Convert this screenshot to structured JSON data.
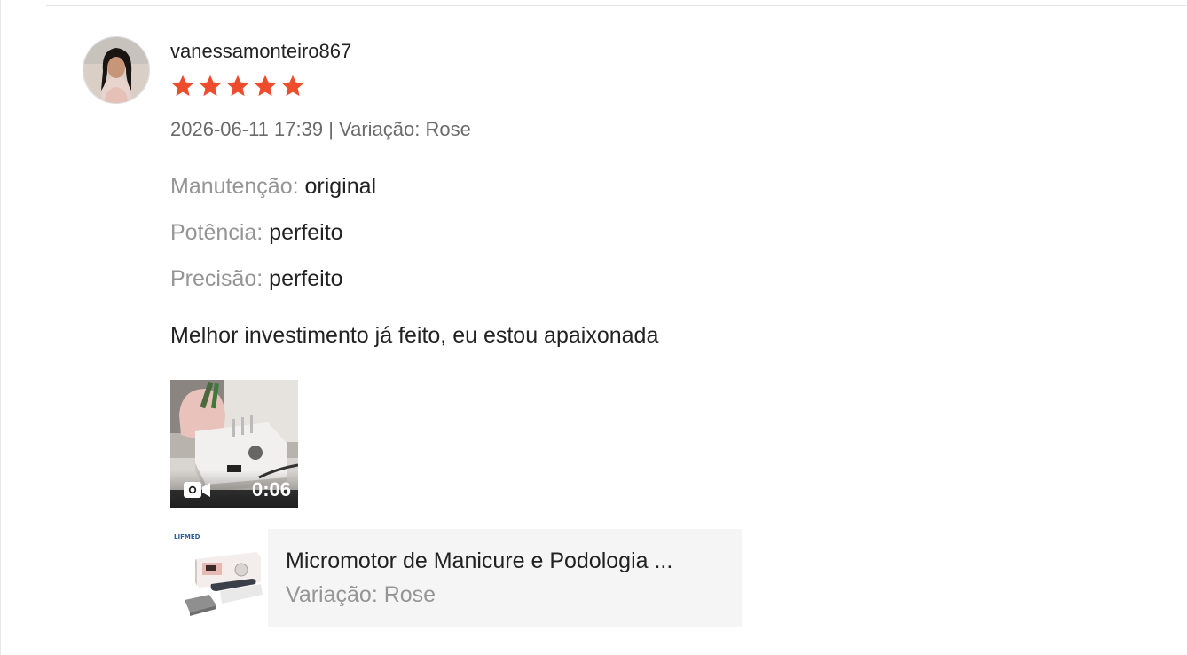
{
  "review": {
    "username": "vanessamonteiro867",
    "rating": 5,
    "rating_max": 5,
    "star_color": "#ee4d2d",
    "date": "2026-06-11 17:39",
    "separator": "|",
    "variation_label": "Variação: Rose",
    "attributes": [
      {
        "key": "Manutenção:",
        "value": "original"
      },
      {
        "key": "Potência:",
        "value": "perfeito"
      },
      {
        "key": "Precisão:",
        "value": "perfeito"
      }
    ],
    "comment": "Melhor investimento já feito, eu estou apaixonada",
    "video": {
      "duration": "0:06",
      "icon": "video-camera-icon"
    }
  },
  "product": {
    "brand": "LIFMED",
    "name": "Micromotor de Manicure e Podologia ...",
    "variation": "Variação: Rose"
  }
}
